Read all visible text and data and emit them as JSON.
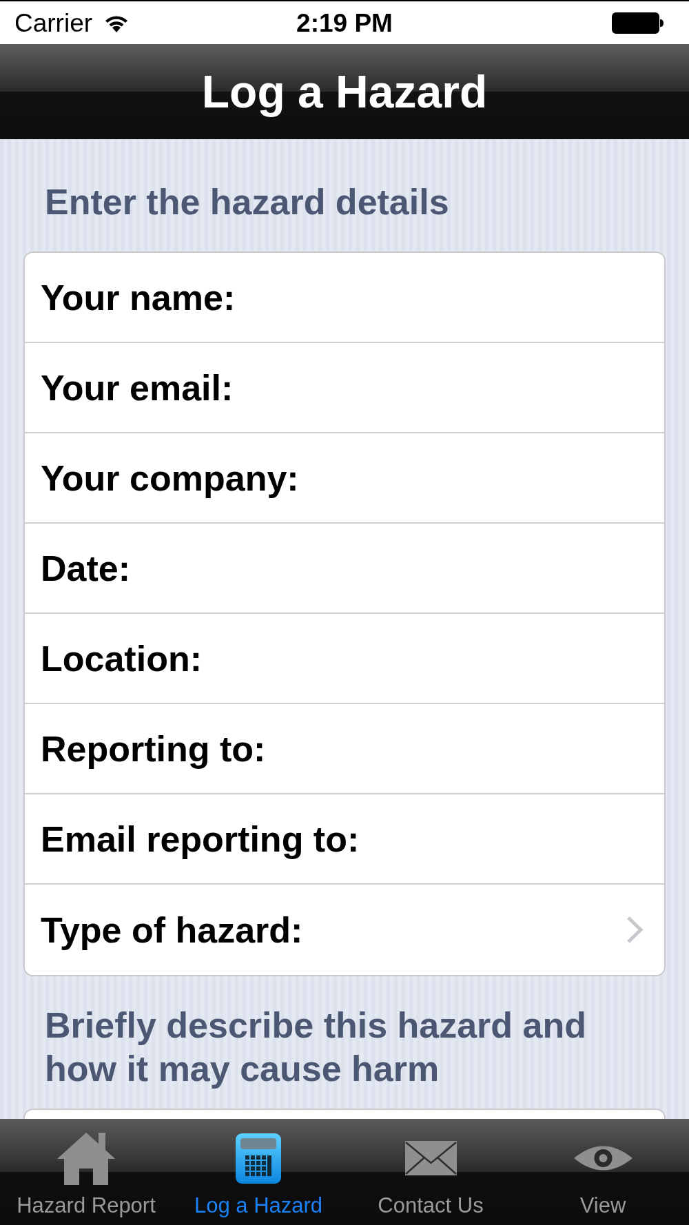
{
  "status_bar": {
    "carrier": "Carrier",
    "time": "2:19 PM"
  },
  "nav_bar": {
    "title": "Log a Hazard"
  },
  "details": {
    "header": "Enter the hazard details",
    "rows": [
      {
        "label": "Your name:",
        "kind": "text"
      },
      {
        "label": "Your email:",
        "kind": "text"
      },
      {
        "label": "Your company:",
        "kind": "text"
      },
      {
        "label": "Date:",
        "kind": "text"
      },
      {
        "label": "Location:",
        "kind": "text"
      },
      {
        "label": "Reporting to:",
        "kind": "text"
      },
      {
        "label": "Email reporting to:",
        "kind": "text"
      },
      {
        "label": "Type of hazard:",
        "kind": "picker"
      }
    ]
  },
  "description": {
    "header": "Briefly describe this hazard and how it may cause harm"
  },
  "tab_bar": {
    "items": [
      {
        "label": "Hazard Report",
        "selected": false
      },
      {
        "label": "Log a Hazard",
        "selected": true
      },
      {
        "label": "Contact Us",
        "selected": false
      },
      {
        "label": "View",
        "selected": false
      }
    ]
  }
}
